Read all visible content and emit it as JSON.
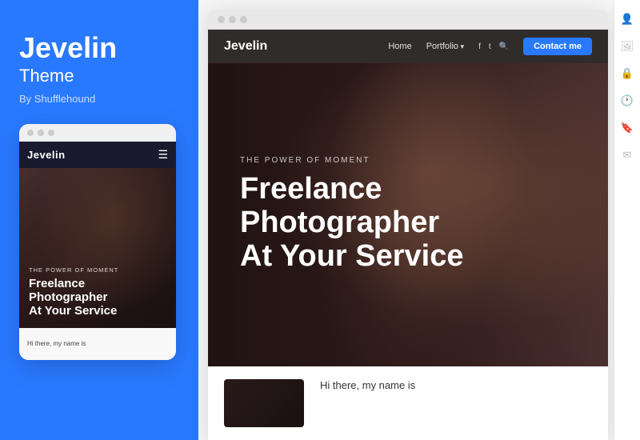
{
  "left_panel": {
    "theme_title": "Jevelin",
    "theme_subtitle": "Theme",
    "theme_author": "By Shufflehound"
  },
  "mobile_preview": {
    "dots": [
      "dot1",
      "dot2",
      "dot3"
    ],
    "nav_logo": "Jevelin",
    "tagline": "THE POWER OF MOMENT",
    "headline_line1": "Freelance",
    "headline_line2": "Photographer",
    "headline_line3": "At Your Service",
    "bottom_text": "Hi there, my name is"
  },
  "desktop_preview": {
    "browser_dots": [
      "dot1",
      "dot2",
      "dot3"
    ],
    "nav": {
      "logo": "Jevelin",
      "links": [
        "Home",
        "Portfolio"
      ],
      "contact_label": "Contact me"
    },
    "hero": {
      "tagline": "THE POWER OF MOMENT",
      "headline_line1": "Freelance Photographer",
      "headline_line2": "At Your Service"
    },
    "below": {
      "text": "Hi there, my name is"
    }
  },
  "right_sidebar": {
    "icons": [
      "person-icon",
      "image-icon",
      "lock-icon",
      "clock-icon",
      "bookmark-icon",
      "mail-icon"
    ]
  }
}
